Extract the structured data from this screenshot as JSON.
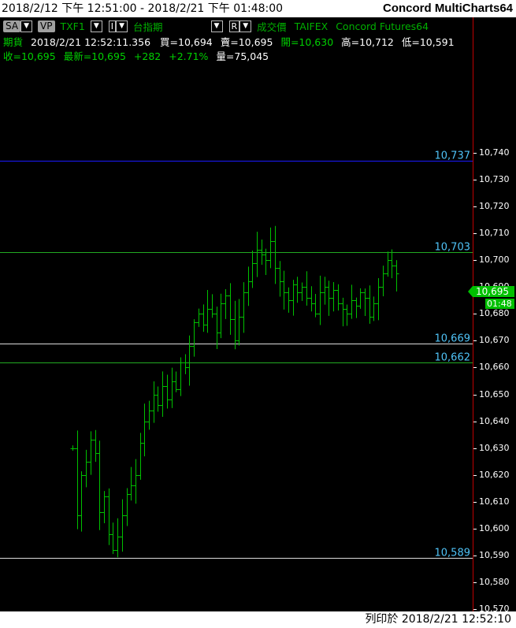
{
  "window": {
    "date_range": "2018/2/12 下午 12:51:00 - 2018/2/21 下午 01:48:00",
    "app_title": "Concord MultiCharts64"
  },
  "toolbar": {
    "sa_label": "SA",
    "vp_label": "VP",
    "symbol": "TXF1",
    "interval_label": "I",
    "exchange_name": "台指期",
    "r_label": "R",
    "field_name": "成交價",
    "exchange": "TAIFEX",
    "data_source": "Concord Futures64"
  },
  "quote_line1": {
    "type_label": "期貨",
    "datetime": "2018/2/21   12:52:11.356",
    "bid": "買=10,694",
    "ask": "賣=10,695",
    "open": "開=10,630",
    "high": "高=10,712",
    "low": "低=10,591"
  },
  "quote_line2": {
    "close": "收=10,695",
    "last": "最新=10,695",
    "change": "+282",
    "change_pct": "+2.71%",
    "volume": "量=75,045"
  },
  "footer": {
    "printed_at": "列印於 2018/2/21 12:52:10"
  },
  "price_marker": {
    "price": "10,695",
    "time": "01:48"
  },
  "colors": {
    "background": "#000000",
    "bar": "#00c000",
    "label": "#4fc3f7",
    "line_blue": "#1a1aff",
    "line_green": "#22aa22",
    "line_white": "#dddddd",
    "axis_divider": "#c00000"
  },
  "chart_data": {
    "type": "ohlc",
    "ylim": [
      10570,
      10745
    ],
    "y_ticks": [
      "10,570",
      "10,580",
      "10,590",
      "10,600",
      "10,610",
      "10,620",
      "10,630",
      "10,640",
      "10,650",
      "10,660",
      "10,670",
      "10,680",
      "10,690",
      "10,700",
      "10,710",
      "10,720",
      "10,730",
      "10,740"
    ],
    "y_tick_values": [
      10570,
      10580,
      10590,
      10600,
      10610,
      10620,
      10630,
      10640,
      10650,
      10660,
      10670,
      10680,
      10690,
      10700,
      10710,
      10720,
      10730,
      10740
    ],
    "levels": [
      {
        "label": "10,737",
        "value": 10737,
        "color": "#1a1aff"
      },
      {
        "label": "10,703",
        "value": 10703,
        "color": "#22aa22"
      },
      {
        "label": "10,669",
        "value": 10669,
        "color": "#dddddd"
      },
      {
        "label": "10,662",
        "value": 10662,
        "color": "#22aa22"
      },
      {
        "label": "10,589",
        "value": 10589,
        "color": "#dddddd"
      }
    ],
    "close_values": [
      10630,
      10605,
      10620,
      10625,
      10633,
      10628,
      10606,
      10612,
      10598,
      10592,
      10597,
      10605,
      10613,
      10616,
      10620,
      10632,
      10640,
      10644,
      10650,
      10646,
      10653,
      10648,
      10655,
      10652,
      10662,
      10660,
      10668,
      10677,
      10680,
      10676,
      10682,
      10680,
      10673,
      10684,
      10687,
      10678,
      10670,
      10679,
      10688,
      10692,
      10699,
      10704,
      10702,
      10700,
      10707,
      10697,
      10692,
      10688,
      10685,
      10691,
      10688,
      10690,
      10686,
      10684,
      10680,
      10688,
      10690,
      10686,
      10689,
      10684,
      10682,
      10680,
      10685,
      10683,
      10688,
      10686,
      10679,
      10684,
      10690,
      10695,
      10700,
      10698,
      10695
    ]
  }
}
